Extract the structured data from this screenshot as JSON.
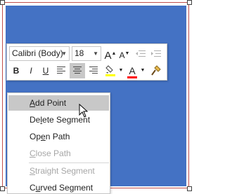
{
  "toolbar": {
    "font_name": "Calibri (Body)",
    "font_size": "18",
    "grow_font_icon": "A",
    "shrink_font_icon": "A",
    "bold": "B",
    "italic": "I",
    "underline": "U",
    "font_color_icon": "A",
    "font_color": "#ff0000",
    "highlight_color": "#ffff00"
  },
  "menu": {
    "items": [
      {
        "pre": "",
        "key": "A",
        "post": "dd Point",
        "enabled": true,
        "hover": true
      },
      {
        "pre": "De",
        "key": "l",
        "post": "ete Segment",
        "enabled": true,
        "hover": false
      },
      {
        "pre": "Op",
        "key": "e",
        "post": "n Path",
        "enabled": true,
        "hover": false
      },
      {
        "pre": "",
        "key": "C",
        "post": "lose Path",
        "enabled": false,
        "hover": false
      },
      {
        "pre": "",
        "key": "S",
        "post": "traight Segment",
        "enabled": false,
        "hover": false
      },
      {
        "pre": "C",
        "key": "u",
        "post": "rved Segment",
        "enabled": true,
        "hover": false
      }
    ]
  },
  "colors": {
    "shape_fill": "#4472c4",
    "frame_border": "#c0504d",
    "hover_bg": "#c8c8c8"
  }
}
